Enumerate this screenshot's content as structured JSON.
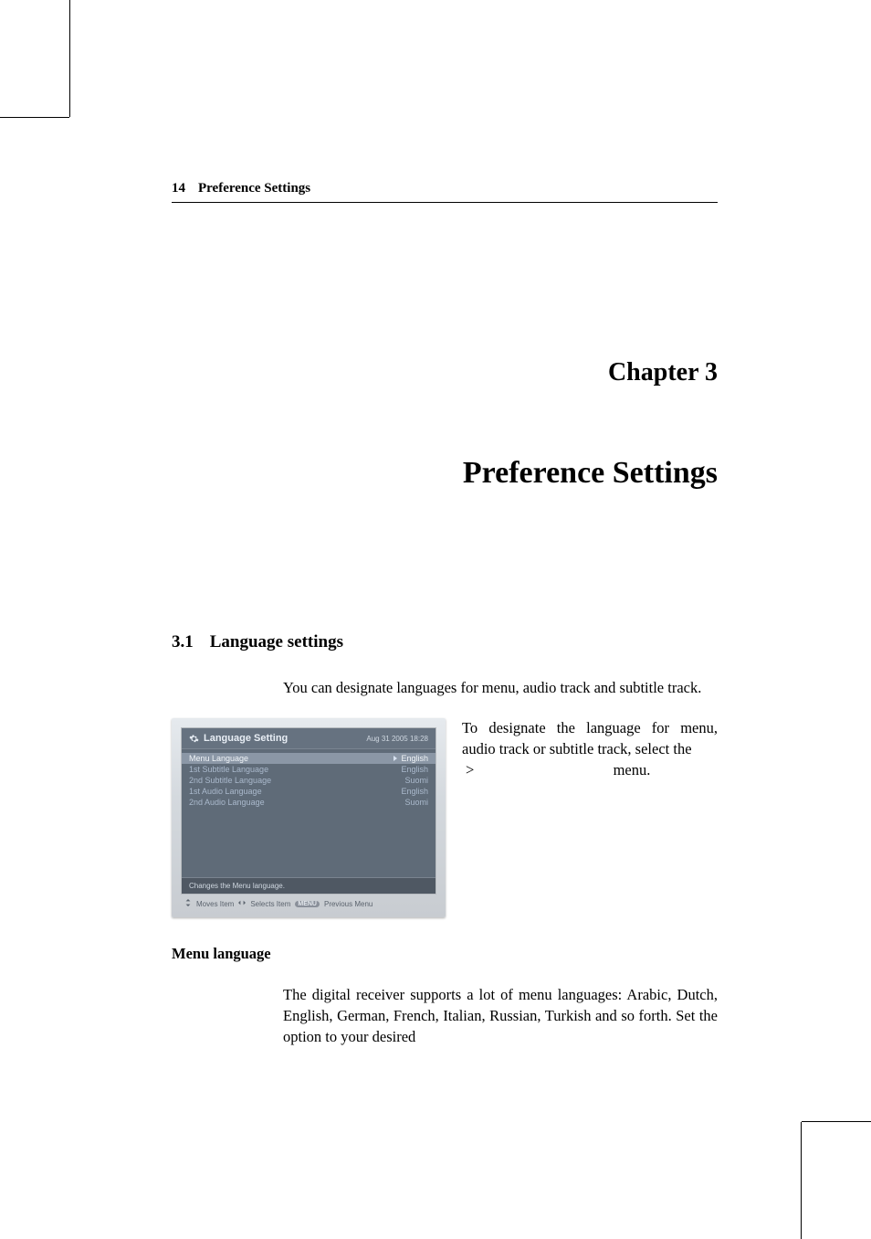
{
  "running_head": {
    "page_number": "14",
    "title": "Preference Settings"
  },
  "chapter": {
    "label": "Chapter 3",
    "title": "Preference Settings"
  },
  "section": {
    "number": "3.1",
    "title": "Language settings"
  },
  "intro_paragraph": "You can designate languages for menu, audio track and subtitle track.",
  "screenshot": {
    "title": "Language Setting",
    "datetime": "Aug 31 2005 18:28",
    "rows": [
      {
        "label": "Menu Language",
        "value": "English",
        "selected": true
      },
      {
        "label": "1st Subtitle Language",
        "value": "English",
        "selected": false
      },
      {
        "label": "2nd Subtitle Language",
        "value": "Suomi",
        "selected": false
      },
      {
        "label": "1st Audio Language",
        "value": "English",
        "selected": false
      },
      {
        "label": "2nd Audio Language",
        "value": "Suomi",
        "selected": false
      }
    ],
    "hint": "Changes the Menu language.",
    "footer": {
      "moves": "Moves Item",
      "selects": "Selects Item",
      "menu_pill": "MENU",
      "previous": "Previous Menu"
    }
  },
  "side_paragraph": {
    "line1": "To designate the language for menu, audio track or subtitle track, select the",
    "gt": ">",
    "line2": "menu."
  },
  "subheading": "Menu language",
  "body_paragraph": "The digital receiver supports a lot of menu languages: Arabic, Dutch, English, German, French, Italian, Russian, Turkish and so forth.  Set the                           option to your desired"
}
